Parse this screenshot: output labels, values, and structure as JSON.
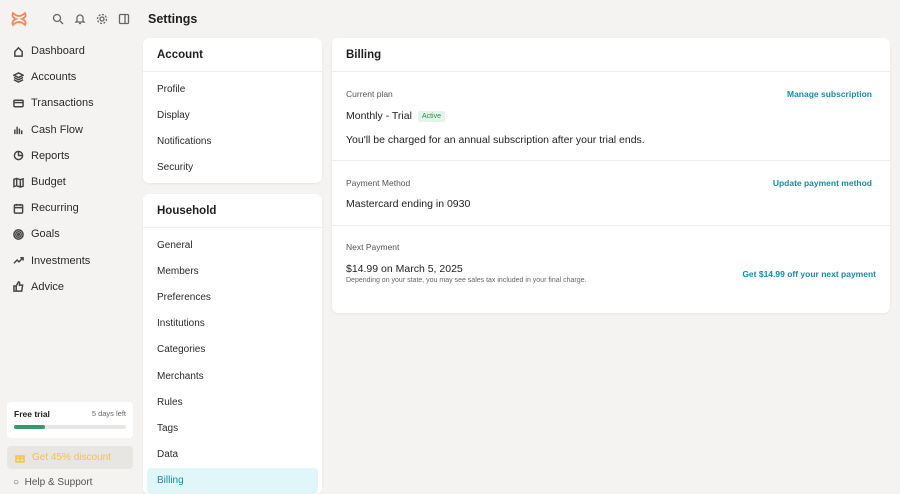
{
  "sidebar": {
    "items": [
      {
        "label": "Dashboard",
        "icon": "home-icon"
      },
      {
        "label": "Accounts",
        "icon": "layers-icon"
      },
      {
        "label": "Transactions",
        "icon": "credit-card-icon"
      },
      {
        "label": "Cash Flow",
        "icon": "bar-chart-icon"
      },
      {
        "label": "Reports",
        "icon": "pie-chart-icon"
      },
      {
        "label": "Budget",
        "icon": "map-icon"
      },
      {
        "label": "Recurring",
        "icon": "calendar-icon"
      },
      {
        "label": "Goals",
        "icon": "target-icon"
      },
      {
        "label": "Investments",
        "icon": "trending-up-icon"
      },
      {
        "label": "Advice",
        "icon": "thumbs-up-icon"
      }
    ],
    "trial": {
      "label": "Free trial",
      "days_left": "5 days left",
      "progress": 0.28
    },
    "discount": "Get 45% discount",
    "help": "Help & Support"
  },
  "page_title": "Settings",
  "account": {
    "title": "Account",
    "items": [
      "Profile",
      "Display",
      "Notifications",
      "Security"
    ]
  },
  "household": {
    "title": "Household",
    "items": [
      "General",
      "Members",
      "Preferences",
      "Institutions",
      "Categories",
      "Merchants",
      "Rules",
      "Tags",
      "Data",
      "Billing"
    ],
    "active": "Billing"
  },
  "billing": {
    "title": "Billing",
    "plan": {
      "label": "Current plan",
      "link": "Manage subscription",
      "name": "Monthly - Trial",
      "badge": "Active",
      "note": "You'll be charged for an annual subscription after your trial ends."
    },
    "payment_method": {
      "label": "Payment Method",
      "link": "Update payment method",
      "value": "Mastercard ending in 0930"
    },
    "next_payment": {
      "label": "Next Payment",
      "link": "Get $14.99 off your next payment",
      "value": "$14.99 on March 5, 2025",
      "note": "Depending on your state, you may see sales tax included in your final charge."
    }
  },
  "colors": {
    "accent": "#1a8aa0",
    "progress": "#2f9e6a",
    "logo": "#f08a5d",
    "discount": "#f2c14e"
  }
}
